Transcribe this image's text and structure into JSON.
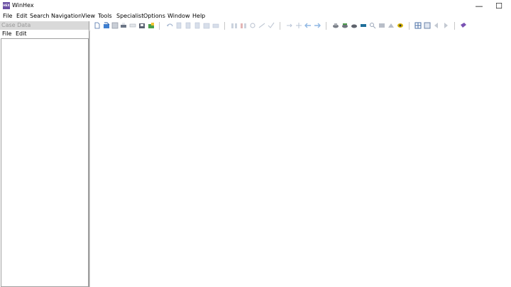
{
  "window": {
    "title": "WinHex",
    "icon_text": "HEX",
    "minimize_glyph": "—",
    "maximize_glyph": "☐"
  },
  "menu": [
    "File",
    "Edit",
    "Search",
    "Navigation",
    "View",
    "Tools",
    "Specialist",
    "Options",
    "Window",
    "Help"
  ],
  "case_panel": {
    "title": "Case Data",
    "menu": [
      "File",
      "Edit"
    ]
  },
  "toolbar": {
    "icons": [
      "new-file-icon",
      "open-file-icon",
      "save-icon",
      "print-icon",
      "properties-icon",
      "open-disk-icon",
      "snapshot-icon",
      "undo-icon",
      "cut-icon",
      "copy-icon",
      "paste-icon",
      "paste-special-icon",
      "clipboard-icon",
      "find-text-icon",
      "find-hex-icon",
      "replace-text-icon",
      "replace-hex-icon",
      "find-again-icon",
      "goto-offset-icon",
      "goto-sector-icon",
      "back-icon",
      "forward-icon",
      "open-disk-drive-icon",
      "clone-disk-icon",
      "disk-editor-icon",
      "ram-editor-icon",
      "analyze-icon",
      "data-recovery-icon",
      "wipe-icon",
      "technician-icon",
      "case-view-icon",
      "grid-view-icon",
      "previous-icon",
      "next-icon",
      "help-book-icon"
    ]
  }
}
